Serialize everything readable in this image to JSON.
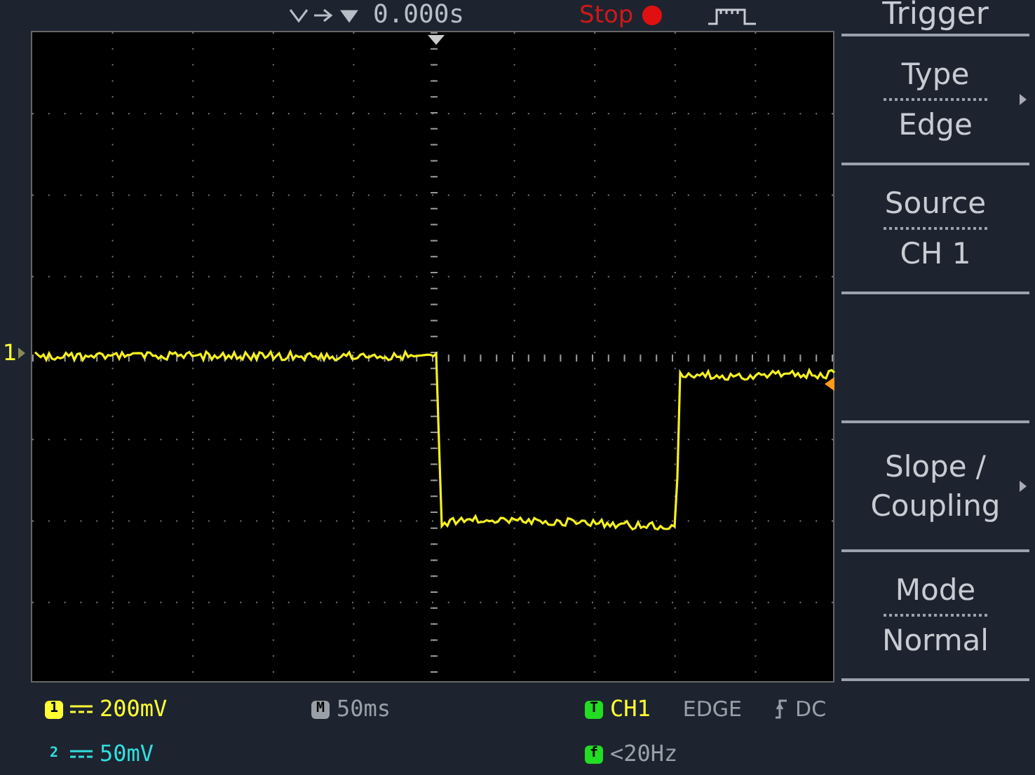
{
  "top_bar": {
    "position": "0.000s",
    "run_state": "Stop"
  },
  "menu": {
    "title": "Trigger",
    "items": [
      {
        "kind": "pair",
        "label": "Type",
        "value": "Edge",
        "has_submenu": true
      },
      {
        "kind": "pair",
        "label": "Source",
        "value": "CH 1",
        "has_submenu": false
      },
      {
        "kind": "empty"
      },
      {
        "kind": "single",
        "label": "Slope / Coupling",
        "has_submenu": true
      },
      {
        "kind": "pair",
        "label": "Mode",
        "value": "Normal",
        "has_submenu": false
      }
    ]
  },
  "screen": {
    "channel_marker": "1"
  },
  "status": {
    "channels": [
      {
        "badge": "1",
        "scale": "200mV",
        "color": "#ffff33"
      },
      {
        "badge": "2",
        "scale": "50mV",
        "color": "#33dddd"
      }
    ],
    "timebase": {
      "badge": "M",
      "value": "50ms"
    },
    "trigger": {
      "badge": "T",
      "source": "CH1",
      "type": "EDGE",
      "coupling": "DC"
    },
    "frequency": {
      "badge": "f",
      "value": "<20Hz"
    }
  }
}
